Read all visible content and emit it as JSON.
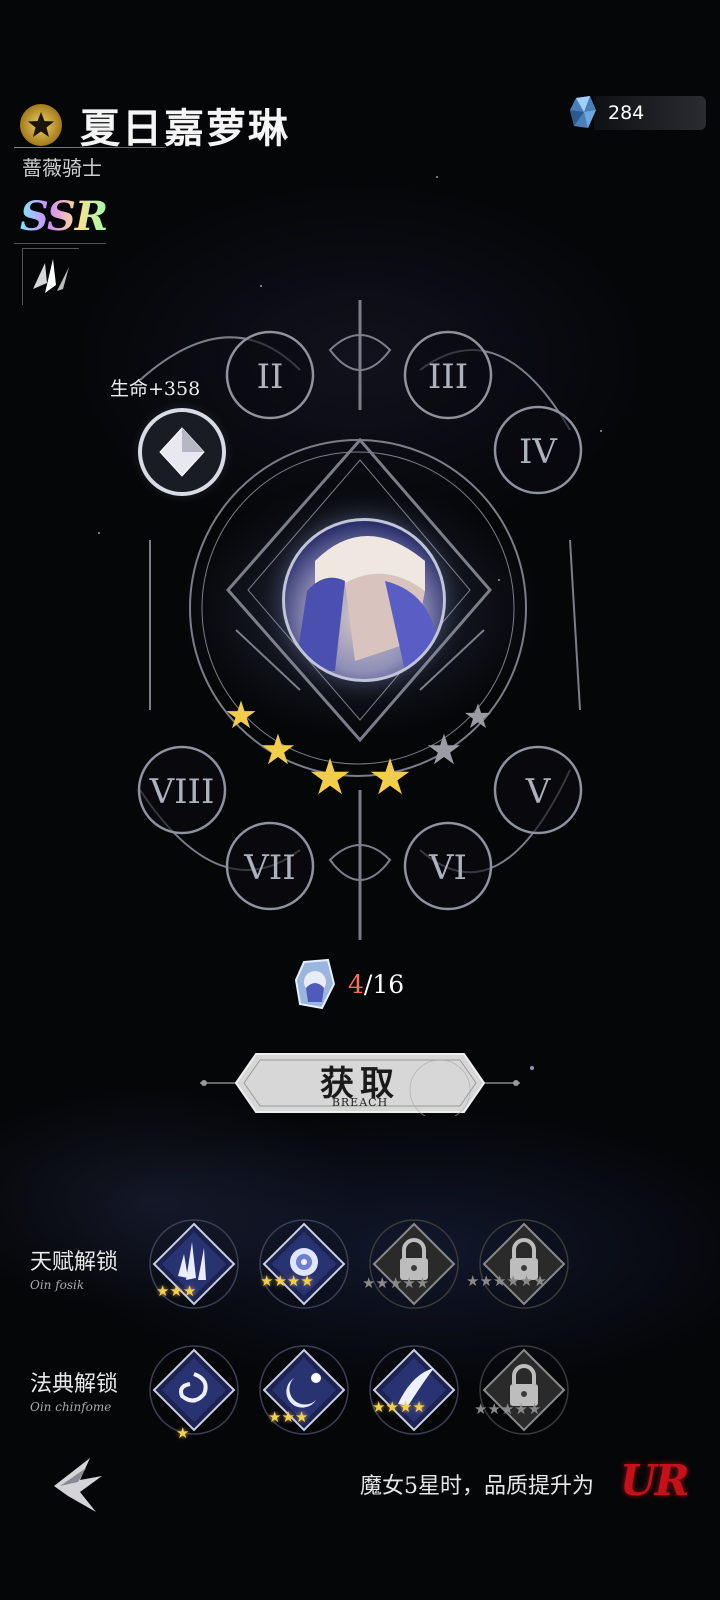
{
  "header": {
    "character_name": "夏日嘉萝琳",
    "subtitle": "蔷薇骑士",
    "rarity": "SSR",
    "currency_amount": "284"
  },
  "constellation": {
    "nodes": [
      "II",
      "III",
      "IV",
      "V",
      "VI",
      "VII",
      "VIII"
    ],
    "active_bonus": "生命+358",
    "stars_lit": 4,
    "stars_total": 6
  },
  "fragments": {
    "current": "4",
    "separator_total": "/16"
  },
  "obtain_button": {
    "label": "获取",
    "sublabel": "BREACH"
  },
  "talent_unlock": {
    "label": "天赋解锁",
    "sublabel": "Oin fosik",
    "skills": [
      {
        "icon": "crystal-shards-icon",
        "stars": 3,
        "locked": false
      },
      {
        "icon": "rose-icon",
        "stars": 4,
        "locked": false
      },
      {
        "icon": "lock-icon",
        "stars": 5,
        "locked": true
      },
      {
        "icon": "lock-icon",
        "stars": 6,
        "locked": true
      }
    ]
  },
  "codex_unlock": {
    "label": "法典解锁",
    "sublabel": "Oin chinfome",
    "skills": [
      {
        "icon": "vortex-icon",
        "stars": 1,
        "locked": false
      },
      {
        "icon": "moon-burst-icon",
        "stars": 3,
        "locked": false
      },
      {
        "icon": "comet-icon",
        "stars": 4,
        "locked": false
      },
      {
        "icon": "lock-icon",
        "stars": 5,
        "locked": true
      }
    ]
  },
  "footer": {
    "promo_text": "魔女5星时，品质提升为",
    "promo_rarity": "UR"
  }
}
